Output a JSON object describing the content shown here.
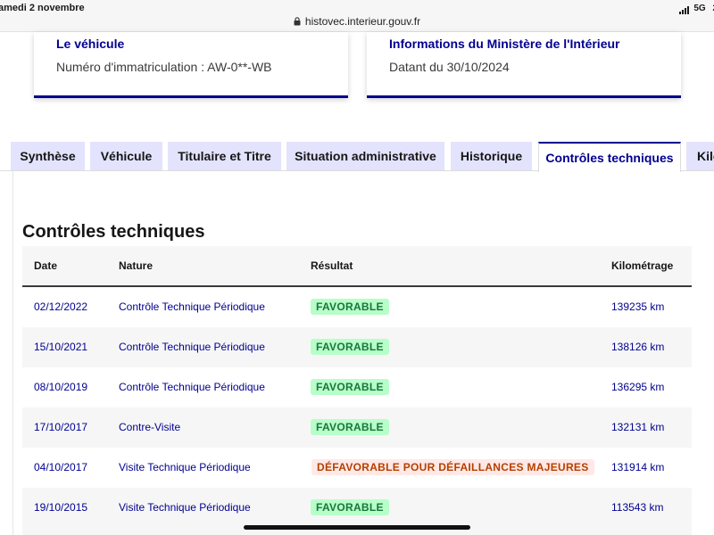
{
  "status_bar": {
    "date": "amedi 2 novembre",
    "url": "histovec.interieur.gouv.fr",
    "network": "5G",
    "battery_text": "2"
  },
  "cards": {
    "vehicle": {
      "title": "Le véhicule",
      "text": "Numéro d'immatriculation : AW-0**-WB"
    },
    "ministry": {
      "title": "Informations du Ministère de l'Intérieur",
      "text": "Datant du 30/10/2024"
    }
  },
  "tabs": [
    {
      "label": "Synthèse",
      "active": false
    },
    {
      "label": "Véhicule",
      "active": false
    },
    {
      "label": "Titulaire et Titre",
      "active": false
    },
    {
      "label": "Situation administrative",
      "active": false
    },
    {
      "label": "Historique",
      "active": false
    },
    {
      "label": "Contrôles techniques",
      "active": true
    },
    {
      "label": "Kilo",
      "active": false
    }
  ],
  "section": {
    "title": "Contrôles techniques"
  },
  "table": {
    "headers": {
      "date": "Date",
      "nature": "Nature",
      "result": "Résultat",
      "mileage": "Kilométrage"
    },
    "rows": [
      {
        "date": "02/12/2022",
        "nature": "Contrôle Technique Périodique",
        "result": "FAVORABLE",
        "status": "ok",
        "mileage": "139235 km"
      },
      {
        "date": "15/10/2021",
        "nature": "Contrôle Technique Périodique",
        "result": "FAVORABLE",
        "status": "ok",
        "mileage": "138126 km"
      },
      {
        "date": "08/10/2019",
        "nature": "Contrôle Technique Périodique",
        "result": "FAVORABLE",
        "status": "ok",
        "mileage": "136295 km"
      },
      {
        "date": "17/10/2017",
        "nature": "Contre-Visite",
        "result": "FAVORABLE",
        "status": "ok",
        "mileage": "132131 km"
      },
      {
        "date": "04/10/2017",
        "nature": "Visite Technique Périodique",
        "result": "DÉFAVORABLE POUR DÉFAILLANCES MAJEURES",
        "status": "ko",
        "mileage": "131914 km"
      },
      {
        "date": "19/10/2015",
        "nature": "Visite Technique Périodique",
        "result": "FAVORABLE",
        "status": "ok",
        "mileage": "113543 km"
      }
    ]
  },
  "colors": {
    "accent": "#000091",
    "tab_inactive": "#e3e3fd",
    "success_bg": "#b8fec9",
    "success_text": "#18753c",
    "error_bg": "#ffe9e6",
    "error_text": "#b34000"
  }
}
